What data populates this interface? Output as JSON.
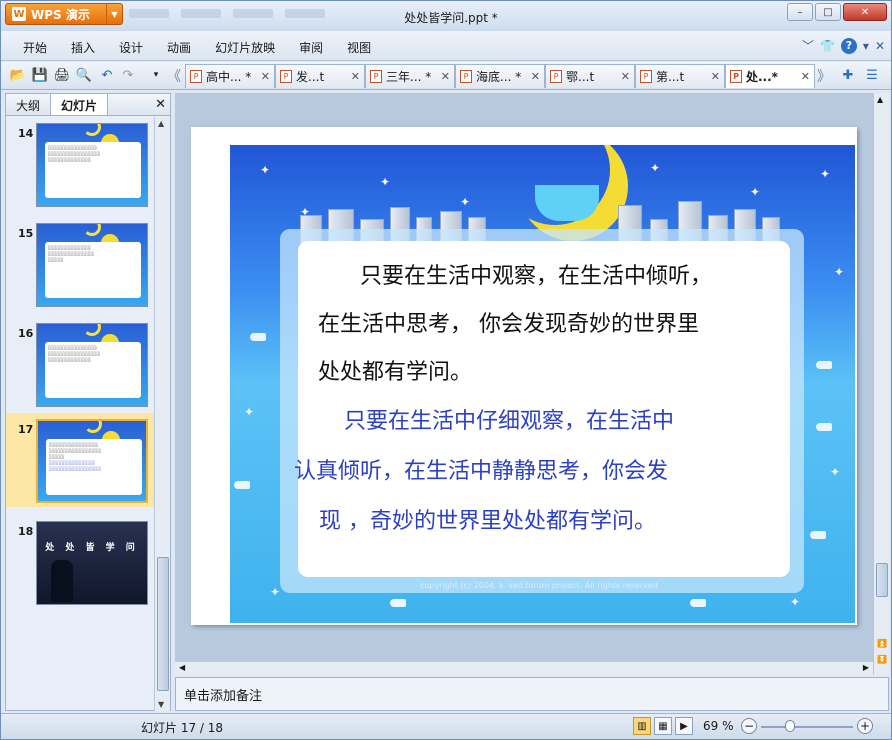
{
  "app": {
    "button_label": "WPS 演示",
    "title": "处处皆学问.ppt *"
  },
  "window": {
    "minimize": "–",
    "maximize": "□",
    "close": "✕"
  },
  "menu": [
    "开始",
    "插入",
    "设计",
    "动画",
    "幻灯片放映",
    "审阅",
    "视图"
  ],
  "tabs": [
    {
      "label": "高中... *",
      "active": false
    },
    {
      "label": "发...t",
      "active": false
    },
    {
      "label": "三年... *",
      "active": false
    },
    {
      "label": "海底... *",
      "active": false
    },
    {
      "label": "鄂...t",
      "active": false
    },
    {
      "label": "第...t",
      "active": false
    },
    {
      "label": "处...*",
      "active": true
    }
  ],
  "left_panel": {
    "tab_outline": "大纲",
    "tab_slides": "幻灯片",
    "close": "✕"
  },
  "thumbnails": [
    {
      "num": "14"
    },
    {
      "num": "15"
    },
    {
      "num": "16"
    },
    {
      "num": "17",
      "selected": true
    },
    {
      "num": "18",
      "title": "处 处 皆 学 问"
    }
  ],
  "slide": {
    "black_lines": [
      "只要在生活中观察，在生活中倾听，",
      "在生活中思考， 你会发现奇妙的世界里",
      "处处都有学问。"
    ],
    "blue_lines": [
      "只要在生活中仔细观察，在生活中",
      "认真倾听，在生活中静静思考，你会发",
      "现 ，奇妙的世界里处处都有学问。"
    ],
    "copyright": "copyright (c) 2004. k. sed.forum project. All rights reserved"
  },
  "notes_placeholder": "单击添加备注",
  "status": {
    "slide_count": "幻灯片 17 / 18",
    "zoom": "69 %"
  },
  "colors": {
    "accent": "#e66f0b",
    "text_blue": "#2b40c6"
  }
}
